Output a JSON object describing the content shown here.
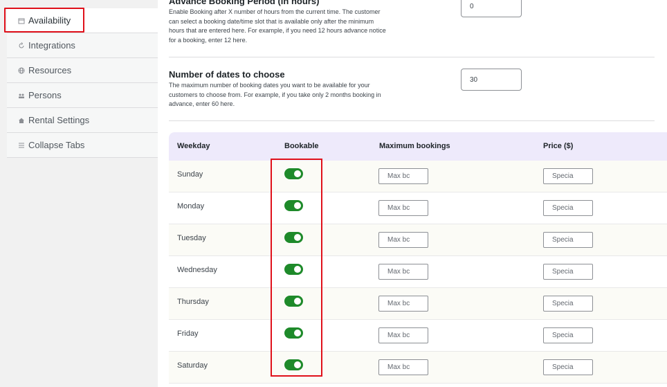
{
  "sidebar": {
    "items": [
      {
        "label": "Availability",
        "icon": "calendar-icon"
      },
      {
        "label": "Integrations",
        "icon": "sync-icon"
      },
      {
        "label": "Resources",
        "icon": "globe-icon"
      },
      {
        "label": "Persons",
        "icon": "people-icon"
      },
      {
        "label": "Rental Settings",
        "icon": "home-icon"
      },
      {
        "label": "Collapse Tabs",
        "icon": "collapse-icon"
      }
    ]
  },
  "fields": {
    "advance": {
      "title": "Advance Booking Period (in hours)",
      "desc": "Enable Booking after X number of hours from the current time. The customer can select a booking date/time slot that is available only after the minimum hours that are entered here. For example, if you need 12 hours advance notice for a booking, enter 12 here.",
      "value": "0"
    },
    "dates": {
      "title": "Number of dates to choose",
      "desc": "The maximum number of booking dates you want to be available for your customers to choose from. For example, if you take only 2 months booking in advance, enter 60 here.",
      "value": "30"
    }
  },
  "table": {
    "headers": {
      "weekday": "Weekday",
      "bookable": "Bookable",
      "max": "Maximum bookings",
      "price": "Price ($)"
    },
    "rows": [
      {
        "day": "Sunday",
        "bookable": true,
        "max_placeholder": "Max bc",
        "price_placeholder": "Specia"
      },
      {
        "day": "Monday",
        "bookable": true,
        "max_placeholder": "Max bc",
        "price_placeholder": "Specia"
      },
      {
        "day": "Tuesday",
        "bookable": true,
        "max_placeholder": "Max bc",
        "price_placeholder": "Specia"
      },
      {
        "day": "Wednesday",
        "bookable": true,
        "max_placeholder": "Max bc",
        "price_placeholder": "Specia"
      },
      {
        "day": "Thursday",
        "bookable": true,
        "max_placeholder": "Max bc",
        "price_placeholder": "Specia"
      },
      {
        "day": "Friday",
        "bookable": true,
        "max_placeholder": "Max bc",
        "price_placeholder": "Specia"
      },
      {
        "day": "Saturday",
        "bookable": true,
        "max_placeholder": "Max bc",
        "price_placeholder": "Specia"
      }
    ]
  },
  "colors": {
    "toggle_on": "#1e8a2a",
    "highlight": "#e0101a",
    "table_header": "#eeeafb"
  }
}
